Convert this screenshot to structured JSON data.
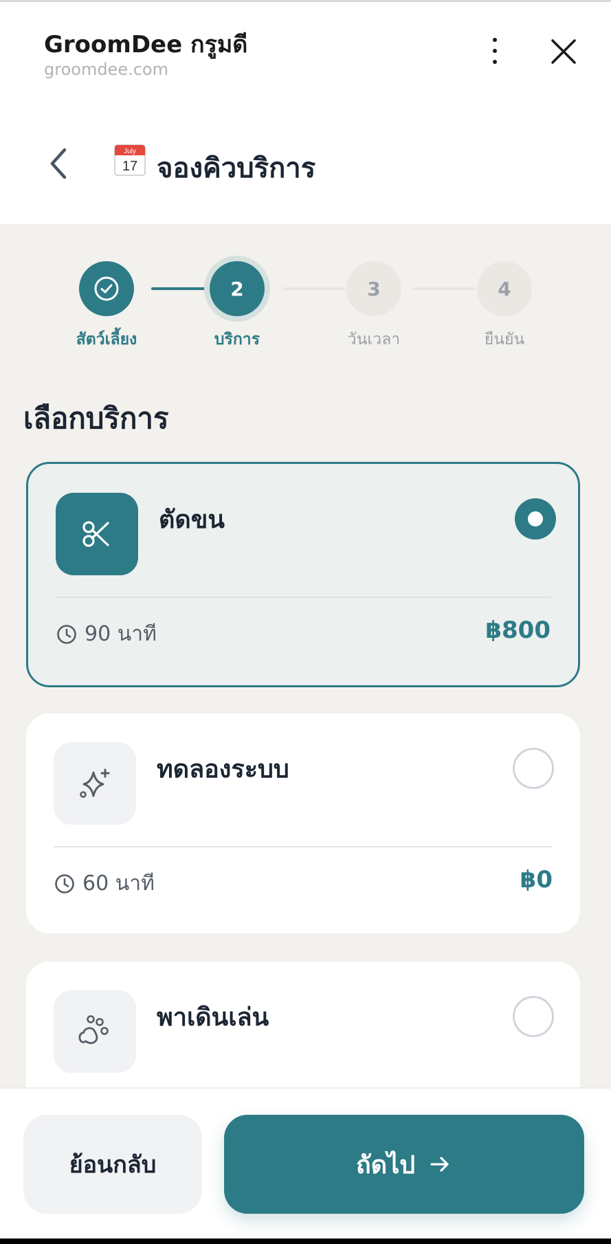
{
  "browser": {
    "site_name": "GroomDee กรูมดี",
    "url": "groomdee.com",
    "menu_icon": "kebab-menu-icon",
    "close_icon": "close-icon"
  },
  "header": {
    "title": "จองคิวบริการ",
    "calendar_month": "July",
    "calendar_day": "17"
  },
  "stepper": {
    "steps": [
      {
        "number": "1",
        "label": "สัตว์เลี้ยง",
        "state": "completed"
      },
      {
        "number": "2",
        "label": "บริการ",
        "state": "active"
      },
      {
        "number": "3",
        "label": "วันเวลา",
        "state": "pending"
      },
      {
        "number": "4",
        "label": "ยืนยัน",
        "state": "pending"
      }
    ]
  },
  "section": {
    "title": "เลือกบริการ"
  },
  "services": [
    {
      "name": "ตัดขน",
      "duration": "90 นาที",
      "price": "฿800",
      "icon": "scissors-icon",
      "selected": true
    },
    {
      "name": "ทดลองระบบ",
      "duration": "60 นาที",
      "price": "฿0",
      "icon": "sparkles-icon",
      "selected": false
    },
    {
      "name": "พาเดินเล่น",
      "duration": "",
      "price": "",
      "icon": "paw-icon",
      "selected": false
    }
  ],
  "footer": {
    "back_label": "ย้อนกลับ",
    "next_label": "ถัดไป"
  },
  "colors": {
    "primary": "#2d7b87",
    "background": "#f3f1ed",
    "selected_card": "#ecf0ef"
  }
}
